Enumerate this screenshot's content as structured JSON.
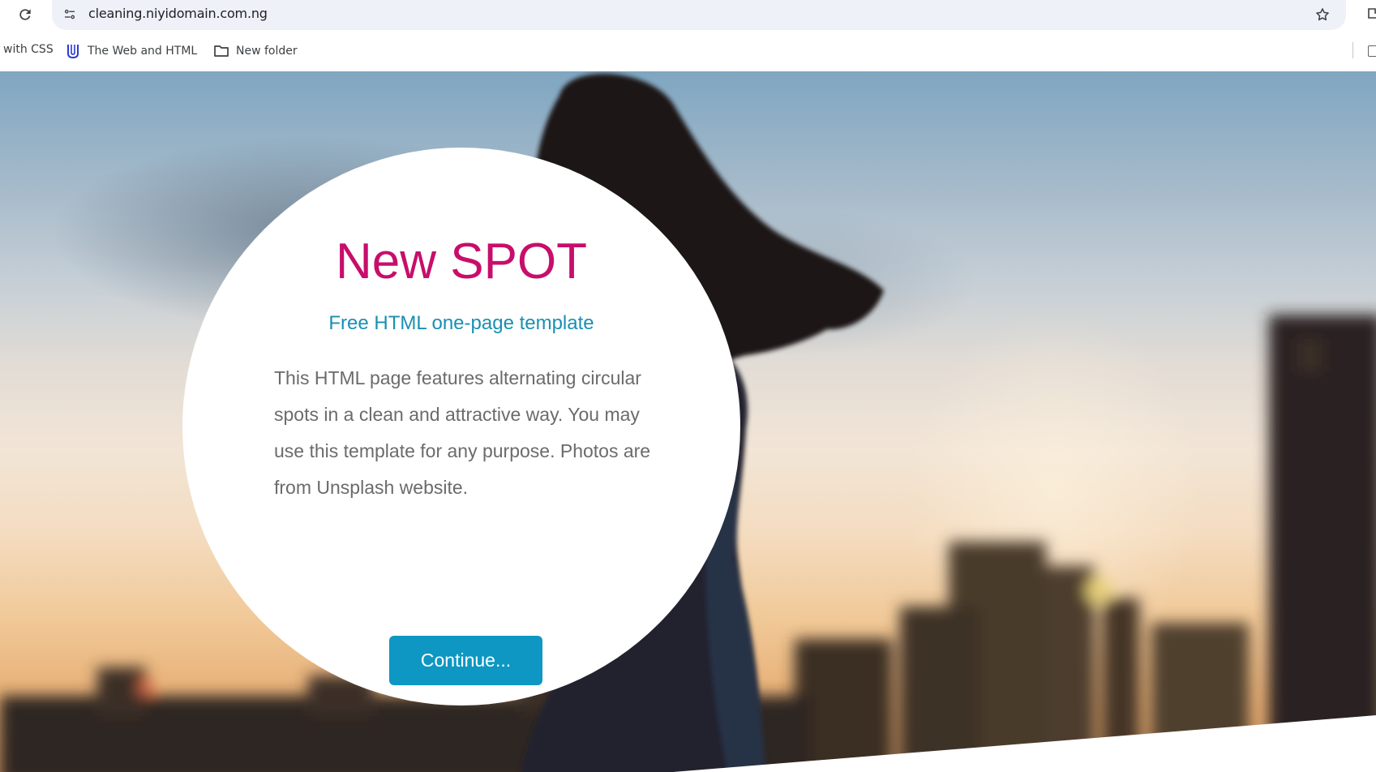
{
  "browser": {
    "url": "cleaning.niyidomain.com.ng",
    "icons": {
      "reload": "reload-icon",
      "site_info": "site-info-icon",
      "bookmark_star": "star-icon"
    },
    "bookmarks": [
      {
        "label": "with CSS",
        "icon": ""
      },
      {
        "label": "The Web and HTML",
        "icon": "udacity-icon"
      },
      {
        "label": "New folder",
        "icon": "folder-icon"
      }
    ]
  },
  "hero": {
    "title": "New SPOT",
    "subtitle": "Free HTML one-page template",
    "body": "This HTML page features alternating circular spots in a clean and attractive way. You may use this template for any purpose. Photos are from Unsplash website.",
    "button_label": "Continue..."
  },
  "colors": {
    "title": "#c70e6b",
    "subtitle": "#1a8fb2",
    "button": "#0e97c2",
    "body_text": "#6b6b6b",
    "omnibox": "#eef1f8"
  }
}
